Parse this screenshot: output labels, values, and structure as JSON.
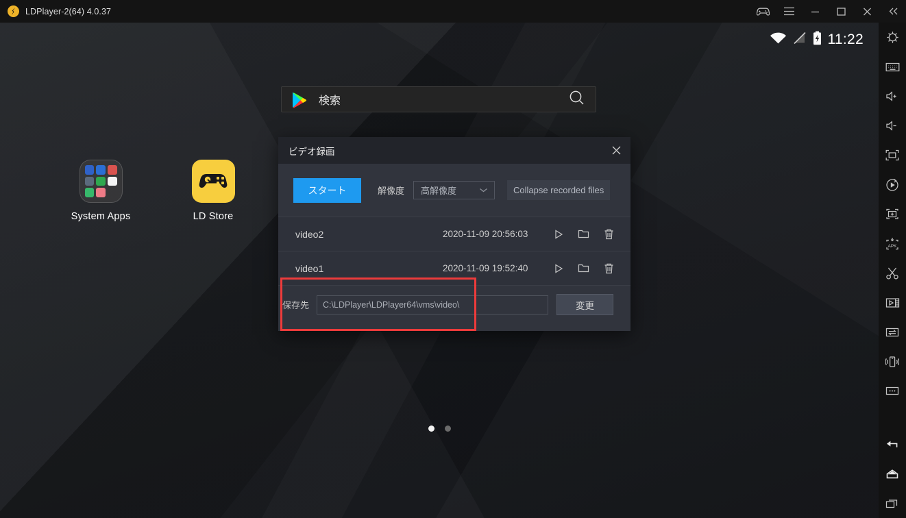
{
  "titlebar": {
    "app_title": "LDPlayer-2(64) 4.0.37",
    "logo_name": "ldplayer-logo",
    "buttons": [
      {
        "name": "gamepad-icon",
        "label": "Gamepad"
      },
      {
        "name": "menu-icon",
        "label": "Menu"
      },
      {
        "name": "minimize-icon",
        "label": "Minimize"
      },
      {
        "name": "maximize-icon",
        "label": "Maximize"
      },
      {
        "name": "close-icon",
        "label": "Close"
      },
      {
        "name": "collapse-icon",
        "label": "Collapse"
      }
    ]
  },
  "statusbar": {
    "wifi_icon": "wifi-icon",
    "signal_icon": "signal-off-icon",
    "battery_icon": "battery-charging-icon",
    "time": "11:22"
  },
  "search": {
    "placeholder": "検索",
    "play_icon": "google-play-icon",
    "magnifier_icon": "search-icon"
  },
  "desktop": {
    "icons": [
      {
        "label": "System Apps",
        "type": "folder"
      },
      {
        "label": "LD Store",
        "type": "app"
      }
    ],
    "folder_tiles": [
      "#2f62c8",
      "#2b6fd4",
      "#d9534f",
      "#5b6a7d",
      "#2fa84f",
      "#f4f4f4",
      "#37b86b",
      "#ef7b87",
      "#2e3440"
    ],
    "page_dots": [
      true,
      false
    ]
  },
  "dialog": {
    "title": "ビデオ録画",
    "close_label": "×",
    "start_button": "スタート",
    "resolution_label": "解像度",
    "resolution_value": "高解像度",
    "collapse_button": "Collapse recorded files",
    "rows": [
      {
        "name": "video2",
        "date": "2020-11-09 20:56:03"
      },
      {
        "name": "video1",
        "date": "2020-11-09 19:52:40"
      }
    ],
    "save_label": "保存先",
    "save_path": "C:\\LDPlayer\\LDPlayer64\\vms\\video\\",
    "change_button": "変更",
    "highlight_color": "#ed3b3b",
    "accent_color": "#1e9af0"
  },
  "sidebar": {
    "items": [
      {
        "name": "settings-icon",
        "label": "Settings"
      },
      {
        "name": "keyboard-icon",
        "label": "Keyboard"
      },
      {
        "name": "volume-up-icon",
        "label": "Volume up"
      },
      {
        "name": "volume-down-icon",
        "label": "Volume down"
      },
      {
        "name": "fullscreen-icon",
        "label": "Fullscreen"
      },
      {
        "name": "rotate-icon",
        "label": "Rotate"
      },
      {
        "name": "add-screen-icon",
        "label": "Add screen"
      },
      {
        "name": "install-apk-icon",
        "label": "Install APK"
      },
      {
        "name": "scissors-icon",
        "label": "Screenshot"
      },
      {
        "name": "video-record-icon",
        "label": "Record video"
      },
      {
        "name": "sync-transfer-icon",
        "label": "Shared folder"
      },
      {
        "name": "shake-icon",
        "label": "Shake"
      },
      {
        "name": "more-icon",
        "label": "More"
      }
    ],
    "nav": [
      {
        "name": "back-icon",
        "label": "Back"
      },
      {
        "name": "home-icon",
        "label": "Home"
      },
      {
        "name": "recents-icon",
        "label": "Recent apps"
      }
    ]
  }
}
